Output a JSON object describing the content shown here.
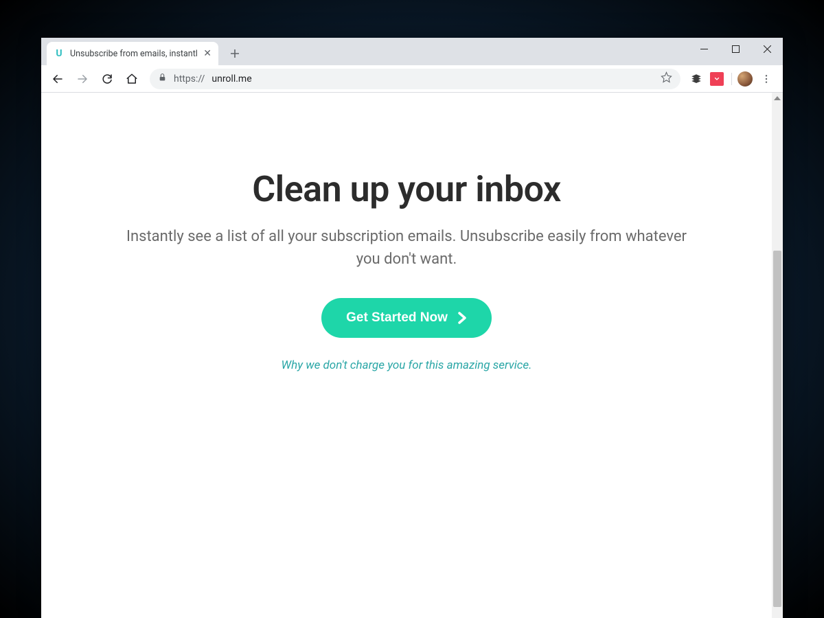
{
  "browser": {
    "tab": {
      "title": "Unsubscribe from emails, instantl",
      "favicon_letter": "U"
    },
    "url_protocol": "https://",
    "url_host": "unroll.me"
  },
  "page": {
    "heading": "Clean up your inbox",
    "subheading": "Instantly see a list of all your subscription emails. Unsubscribe easily from whatever you don't want.",
    "cta_label": "Get Started Now",
    "why_link": "Why we don't charge you for this amazing service."
  },
  "colors": {
    "accent": "#1ed6a9",
    "link": "#2aa6a6"
  }
}
